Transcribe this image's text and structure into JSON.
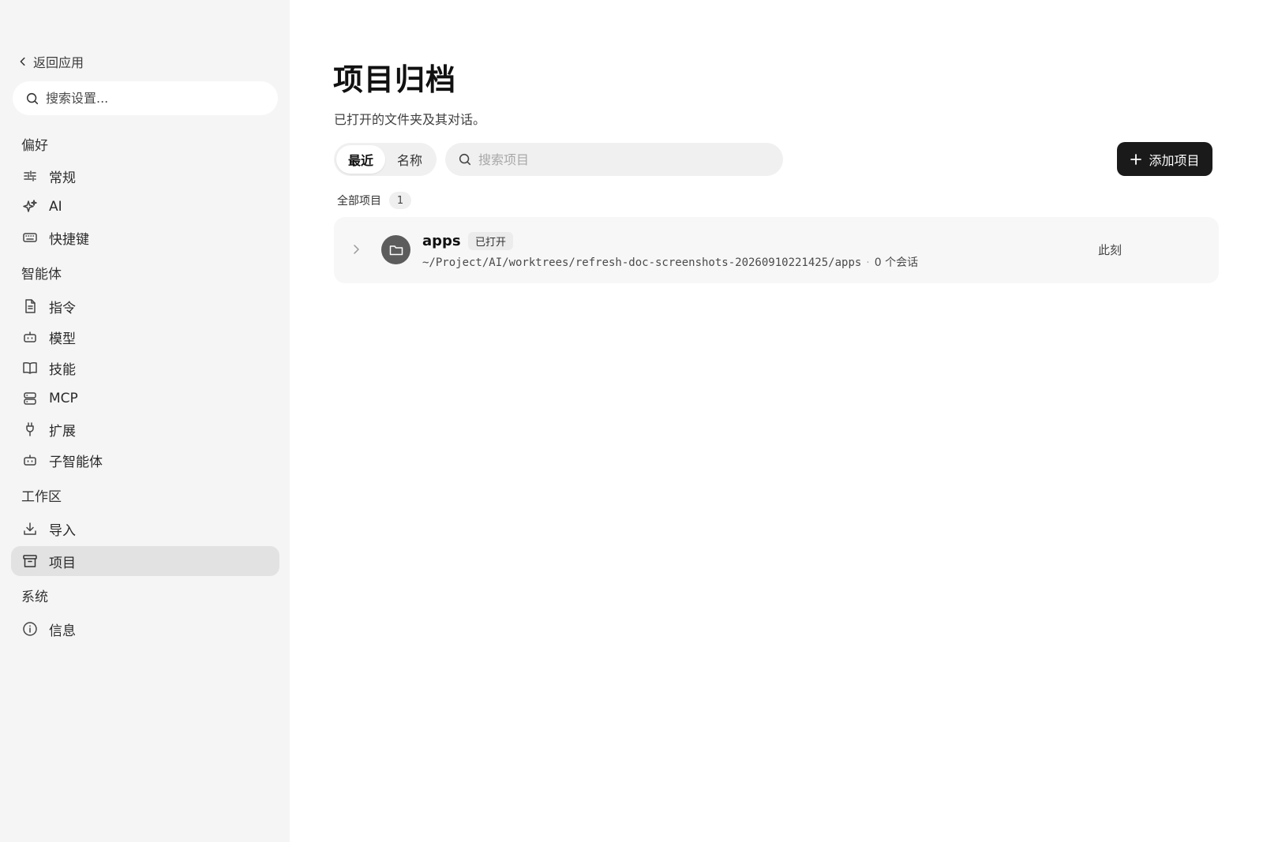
{
  "sidebar": {
    "back_label": "返回应用",
    "search_placeholder": "搜索设置...",
    "sections": {
      "preferences": "偏好",
      "agents": "智能体",
      "workspace": "工作区",
      "system": "系统"
    },
    "items": {
      "general": "常规",
      "ai": "AI",
      "shortcuts": "快捷键",
      "instructions": "指令",
      "models": "模型",
      "skills": "技能",
      "mcp": "MCP",
      "extensions": "扩展",
      "subagents": "子智能体",
      "import": "导入",
      "projects": "项目",
      "info": "信息"
    },
    "active_item": "projects"
  },
  "main": {
    "title": "项目归档",
    "subtitle": "已打开的文件夹及其对话。",
    "sort_tabs": [
      "最近",
      "名称"
    ],
    "active_sort": "最近",
    "search_placeholder": "搜索项目",
    "add_button_label": "添加项目",
    "all_projects_label": "全部项目",
    "all_projects_count": "1",
    "projects": [
      {
        "name": "apps",
        "badge": "已打开",
        "path": "~/Project/AI/worktrees/refresh-doc-screenshots-20260910221425/apps",
        "separator": "·",
        "conversations": "0 个会话",
        "time": "此刻"
      }
    ]
  },
  "colors": {
    "sidebar_bg": "#f5f5f5",
    "active_item_bg": "#e2e2e2",
    "primary_button_bg": "#1a1a1a",
    "row_bg": "#f7f7f7",
    "folder_avatar_bg": "#5c5c5c"
  }
}
